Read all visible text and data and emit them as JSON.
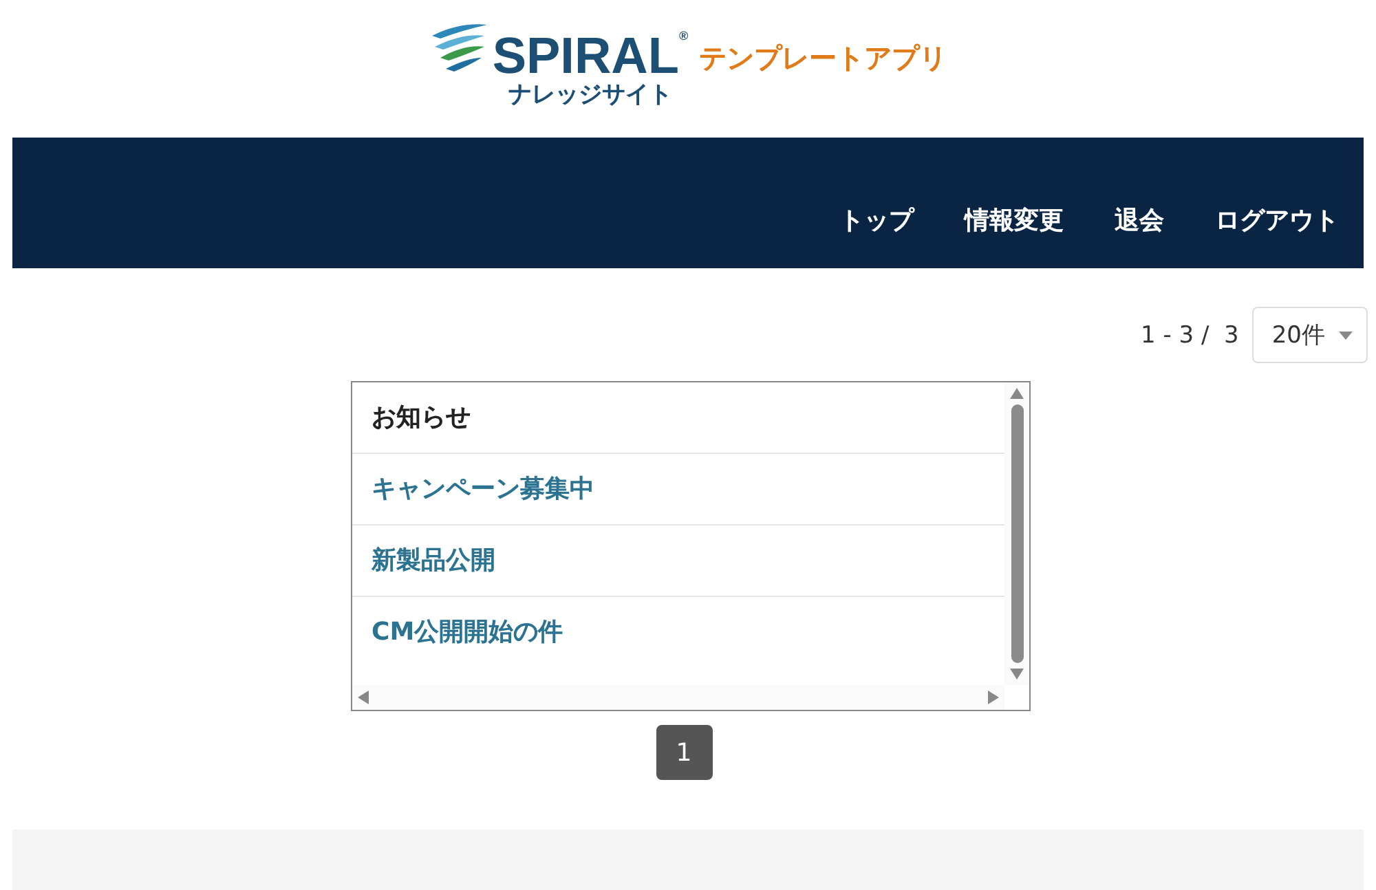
{
  "logo": {
    "brand": "SPIRAL$^{®}$",
    "subtitle": "ナレッジサイト",
    "app_name": "テンプレートアプリ"
  },
  "nav": [
    {
      "label": "トップ"
    },
    {
      "label": "情報変更"
    },
    {
      "label": "退会"
    },
    {
      "label": "ログアウト"
    }
  ],
  "pager": {
    "range": "1 - 3 /  3",
    "per_page": "20件"
  },
  "list": {
    "heading": "お知らせ",
    "items": [
      {
        "label": "キャンペーン募集中"
      },
      {
        "label": "新製品公開"
      },
      {
        "label": "CM公開開始の件"
      }
    ]
  },
  "pages": [
    {
      "label": "1",
      "selected": true
    }
  ]
}
